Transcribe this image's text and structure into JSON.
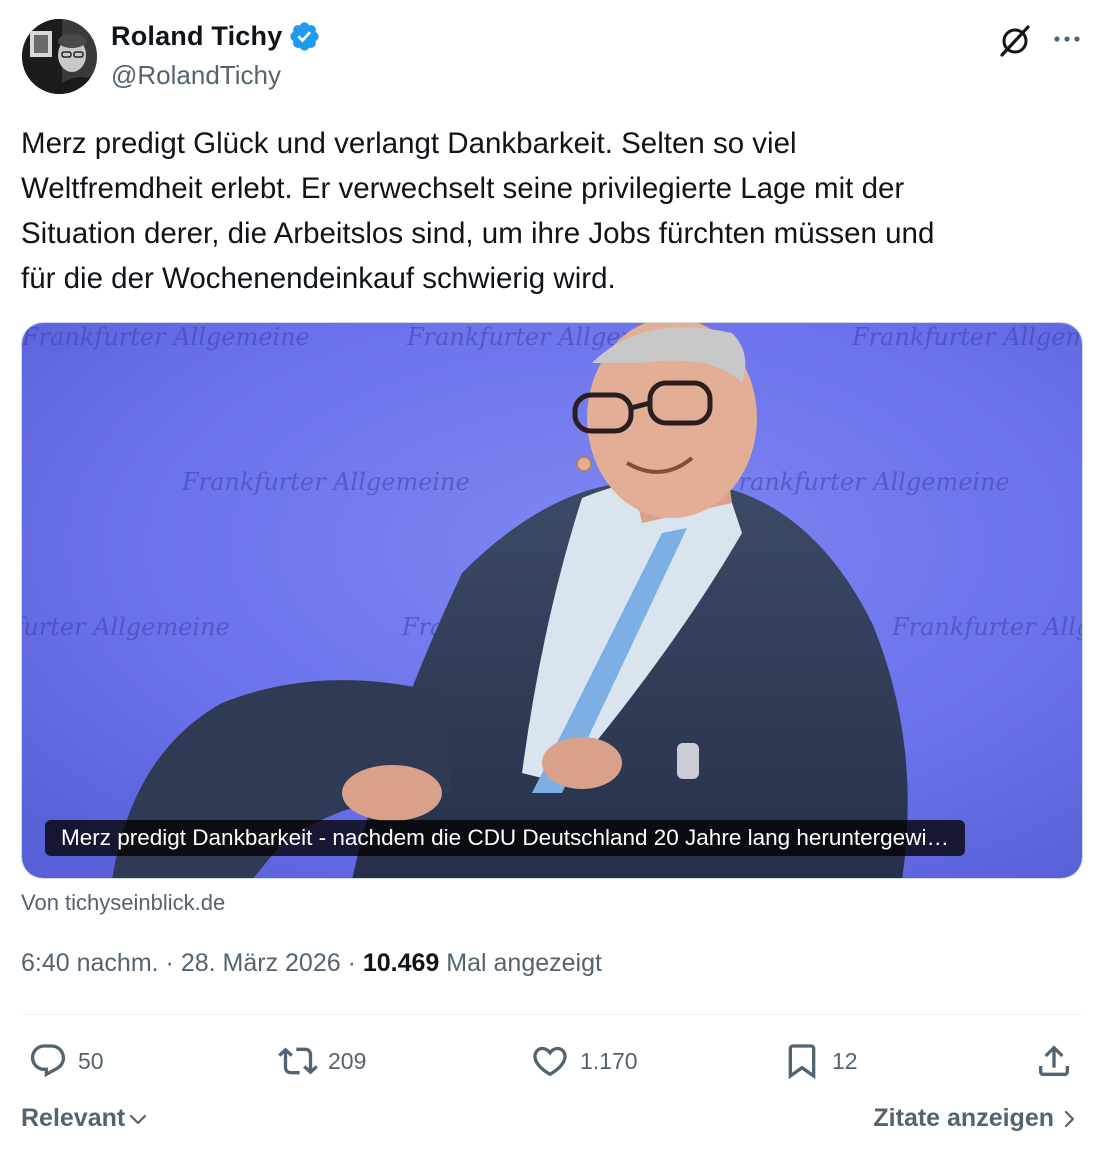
{
  "author": {
    "display_name": "Roland Tichy",
    "handle": "@RolandTichy",
    "verified": true
  },
  "tweet": {
    "text": "Merz predigt Glück und verlangt Dankbarkeit. Selten so viel\nWeltfremdheit erlebt. Er verwechselt seine privilegierte Lage mit der\nSituation derer, die Arbeitslos sind, um ihre Jobs fürchten müssen und\nfür die der Wochenendeinkauf schwierig wird."
  },
  "card": {
    "title": "Merz predigt Dankbarkeit - nachdem die CDU Deutschland 20 Jahre lang heruntergewi…",
    "source": "Von tichyseinblick.de",
    "backdrop_text": "Frankfurter Allgemeine"
  },
  "meta": {
    "time": "6:40 nachm.",
    "separator": " · ",
    "date": "28. März 2026",
    "views_count": "10.469",
    "views_label": "Mal angezeigt"
  },
  "actions": {
    "replies": "50",
    "reposts": "209",
    "likes": "1.170",
    "bookmarks": "12"
  },
  "footer": {
    "sort_label": "Relevant",
    "quotes_label": "Zitate anzeigen"
  },
  "colors": {
    "accent": "#1d9bf0",
    "text": "#0f1419",
    "secondary": "#536471"
  },
  "icons": [
    "verified-badge-icon",
    "grok-icon",
    "more-icon",
    "reply-icon",
    "repost-icon",
    "like-icon",
    "bookmark-icon",
    "share-icon",
    "chevron-down-icon",
    "chevron-right-icon"
  ]
}
